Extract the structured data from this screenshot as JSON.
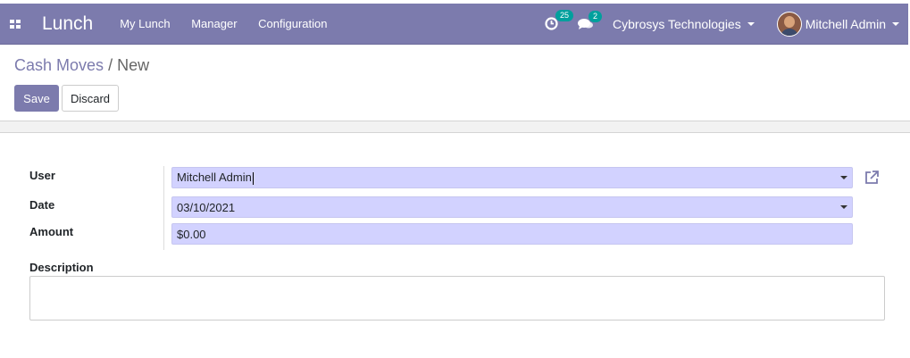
{
  "navbar": {
    "app_name": "Lunch",
    "menu": [
      "My Lunch",
      "Manager",
      "Configuration"
    ],
    "activity_count": "25",
    "message_count": "2",
    "company": "Cybrosys Technologies",
    "user": "Mitchell Admin"
  },
  "breadcrumb": {
    "parent": "Cash Moves",
    "separator": "/",
    "current": "New"
  },
  "actions": {
    "save": "Save",
    "discard": "Discard"
  },
  "form": {
    "user_label": "User",
    "user_value": "Mitchell Admin",
    "date_label": "Date",
    "date_value": "03/10/2021",
    "amount_label": "Amount",
    "amount_value": "$0.00",
    "description_label": "Description",
    "description_value": ""
  },
  "colors": {
    "primary": "#7c7bad",
    "field_bg": "#d2d2ff",
    "badge": "#00a09d"
  }
}
